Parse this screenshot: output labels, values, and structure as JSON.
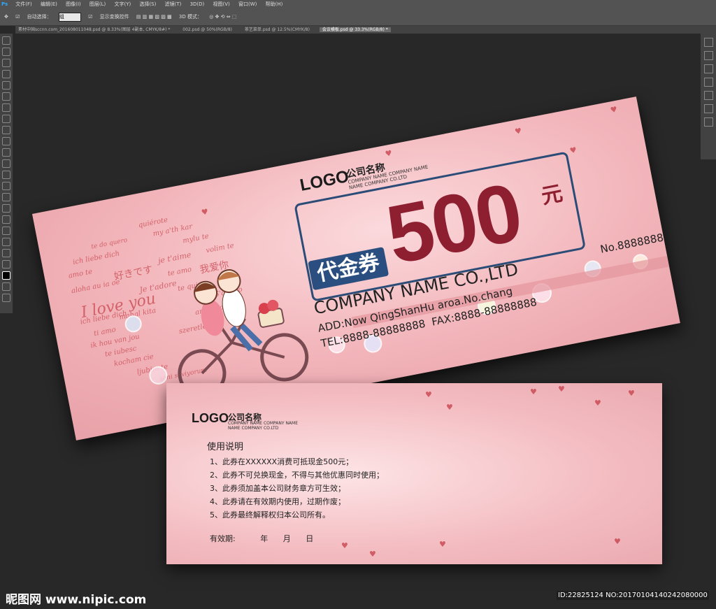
{
  "menubar": {
    "app_icon": "Ps",
    "items": [
      "文件(F)",
      "编辑(E)",
      "图像(I)",
      "图层(L)",
      "文字(Y)",
      "选择(S)",
      "滤镜(T)",
      "3D(D)",
      "视图(V)",
      "窗口(W)",
      "帮助(H)"
    ]
  },
  "options_bar": {
    "auto_select_label": "自动选择：",
    "auto_select_value": "组",
    "show_transform_label": "显示变换控件",
    "mode_3d_label": "3D 模式："
  },
  "tabs": [
    {
      "label": "素材中国sccnn.com_201608011048.psd @ 8.33%(图层 4副本, CMYK/8#) *",
      "active": false
    },
    {
      "label": "002.psd @ 50%(RGB/8)",
      "active": false
    },
    {
      "label": "茶艺菜单.psd @ 12.5%(CMYK/8)",
      "active": false
    },
    {
      "label": "会议横板.psd @ 33.3%(RGB/8) *",
      "active": true
    }
  ],
  "front": {
    "logo": "LOGO",
    "company_cn": "公司名称",
    "company_en_lines": [
      "COMPANY NAME COMPANY NAME",
      "NAME COMPANY CO.LTD"
    ],
    "voucher_label": "代金券",
    "amount": "500",
    "currency": "元",
    "serial": "No.88888888",
    "company_name": "COMPANY NAME CO.,LTD",
    "address": "ADD:Now QingShanHu aroa.No.chang",
    "fax": "FAX:8888-88888888",
    "tel": "TEL:8888-88888888",
    "heart_words": [
      "quiérote",
      "te do quero",
      "my a'th kar",
      "ich liebe dich",
      "mylu te",
      "amo te",
      "I love you",
      "te amo",
      "我爱你",
      "好きです",
      "je t'aime",
      "Je t'adore",
      "te quiero",
      "aloha au ia oe",
      "ti amo",
      "ik hou van jou",
      "te iubesc",
      "volim te",
      "S'agapo",
      "kocham cie",
      "mahal kita",
      "armastan sind",
      "ljubim te",
      "seni seviyorum",
      "ich liebe dich",
      "szeretlek"
    ]
  },
  "back": {
    "logo": "LOGO",
    "company_cn": "公司名称",
    "company_en_lines": [
      "COMPANY NAME COMPANY NAME",
      "NAME COMPANY CO.LTD"
    ],
    "usage_title": "使用说明",
    "rules": [
      "1、此券在XXXXXX消费可抵现金500元；",
      "2、此券不可兑换现金，不得与其他优惠同时使用；",
      "3、此券须加盖本公司财务章方可生效；",
      "4、此券请在有效期内使用，过期作废；",
      "5、此券最终解释权归本公司所有。"
    ],
    "validity_label": "有效期:",
    "year": "年",
    "month": "月",
    "day": "日"
  },
  "watermark": {
    "site": "昵图网 www.nipic.com",
    "id": "ID:22825124 NO:20170104140242080000"
  },
  "colors": {
    "voucher_pink": "#f2b5ba",
    "amount_red": "#8e1f30",
    "badge_blue": "#2a4e7f"
  }
}
